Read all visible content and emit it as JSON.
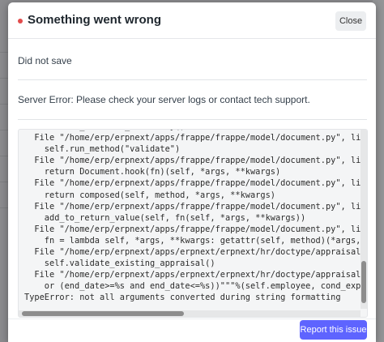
{
  "dialog": {
    "title": "Something went wrong",
    "close_label": "Close",
    "message_1": "Did not save",
    "message_2": "Server Error: Please check your server logs or contact tech support.",
    "traceback": "      self._validate_mandatory()\n  File \"/home/erp/erpnext/apps/frappe/frappe/model/document.py\", line 886, in run_method\n    self.run_method(\"validate\")\n  File \"/home/erp/erpnext/apps/frappe/frappe/model/document.py\", line 772, in run_method\n    return Document.hook(fn)(self, *args, **kwargs)\n  File \"/home/erp/erpnext/apps/frappe/frappe/model/document.py\", line 1048, in composer\n    return composed(self, method, *args, **kwargs)\n  File \"/home/erp/erpnext/apps/frappe/frappe/model/document.py\", line 1031, in runner\n    add_to_return_value(self, fn(self, *args, **kwargs))\n  File \"/home/erp/erpnext/apps/frappe/frappe/model/document.py\", line 766, in <lambda>\n    fn = lambda self, *args, **kwargs: getattr(self, method)(*args, **kwargs)\n  File \"/home/erp/erpnext/apps/erpnext/erpnext/hr/doctype/appraisal/appraisal.py\", line 29\n    self.validate_existing_appraisal()\n  File \"/home/erp/erpnext/apps/erpnext/erpnext/hr/doctype/appraisal/appraisal.py\", line 47\n    or (end_date>=%s and end_date<=%s))\"\"\"%(self.employee, cond_exp, self.start_date))\nTypeError: not all arguments converted during string formatting",
    "report_label": "Report this issue"
  },
  "colors": {
    "accent": "#5e64ff",
    "error_dot": "#e24c4c"
  }
}
